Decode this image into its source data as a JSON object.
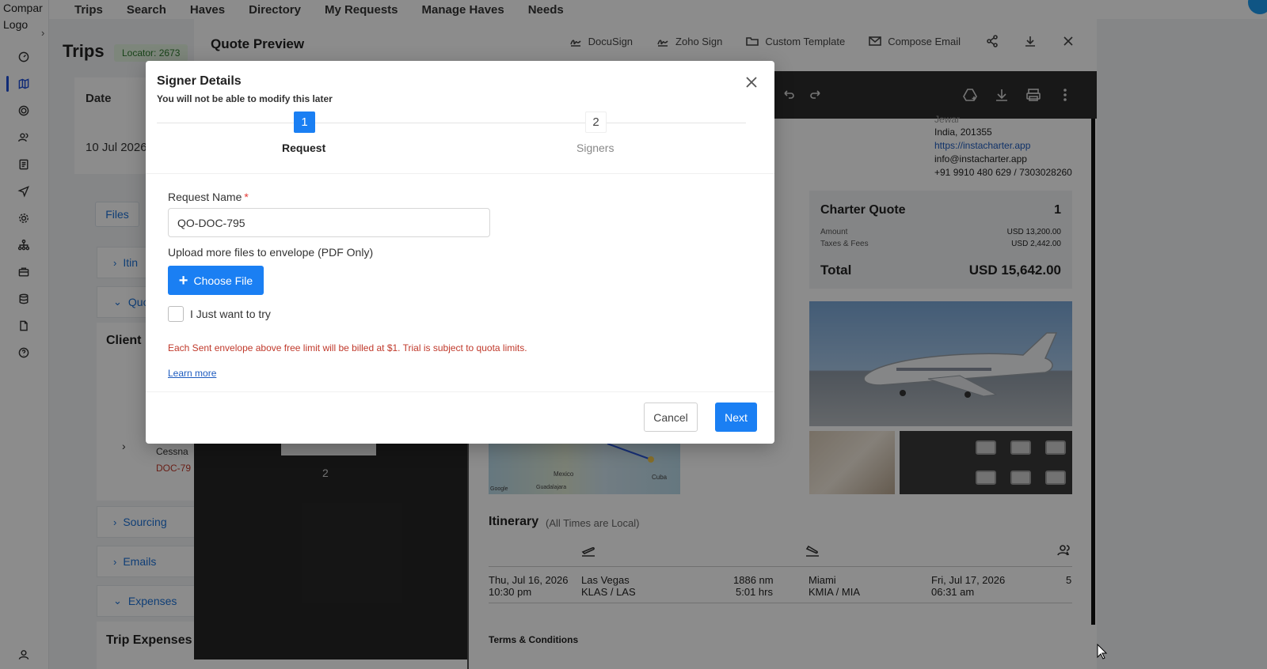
{
  "app": {
    "logo_text": "Compar\nLogo",
    "nav": [
      "Trips",
      "Search",
      "Haves",
      "Directory",
      "My Requests",
      "Manage Haves",
      "Needs"
    ]
  },
  "trips_page": {
    "title": "Trips",
    "locator": "Locator: 2673",
    "date_header": "Date",
    "date_value": "10 Jul 2026",
    "files_button": "Files",
    "accordion_partial_1": "Itin",
    "accordion_partial_2": "Quo",
    "client_title": "Client",
    "aircraft_partial": "Cessna",
    "doc_partial": "DOC-79",
    "sections": [
      "Sourcing",
      "Emails",
      "Expenses"
    ],
    "trip_expenses": "Trip Expenses"
  },
  "quote_preview": {
    "title": "Quote Preview",
    "actions": [
      "DocuSign",
      "Zoho Sign",
      "Custom Template",
      "Compose Email"
    ],
    "thumb_page_number": "2",
    "address_partial": "Jewar",
    "address_line": "India, 201355",
    "website": "https://instacharter.app",
    "email": "info@instacharter.app",
    "phones": "+91 9910 480 629 / 7303028260",
    "charter_quote": {
      "title": "Charter Quote",
      "number": "1",
      "amount_label": "Amount",
      "amount_value": "USD 13,200.00",
      "taxes_label": "Taxes & Fees",
      "taxes_value": "USD 2,442.00",
      "total_label": "Total",
      "total_value": "USD 15,642.00"
    },
    "map_labels": {
      "mexico": "Mexico",
      "cuba": "Cuba",
      "guadalajara": "Guadalajara",
      "google": "Google"
    },
    "itinerary": {
      "title": "Itinerary",
      "subtitle": "(All Times are Local)",
      "depart_date": "Thu, Jul 16, 2026",
      "depart_time": "10:30 pm",
      "origin_city": "Las Vegas",
      "origin_code": "KLAS / LAS",
      "distance": "1886 nm",
      "duration": "5:01 hrs",
      "dest_city": "Miami",
      "dest_code": "KMIA / MIA",
      "arrive_date": "Fri, Jul 17, 2026",
      "arrive_time": "06:31 am",
      "pax": "5"
    },
    "terms": "Terms & Conditions"
  },
  "modal": {
    "title": "Signer Details",
    "subtitle": "You will not be able to modify this later",
    "steps": [
      {
        "number": "1",
        "label": "Request"
      },
      {
        "number": "2",
        "label": "Signers"
      }
    ],
    "request_name_label": "Request Name",
    "request_name_required": "*",
    "request_name_value": "QO-DOC-795",
    "upload_label": "Upload more files to envelope (PDF Only)",
    "choose_file": "Choose File",
    "try_label": "I Just want to try",
    "warning": "Each Sent envelope above free limit will be billed at $1. Trial is subject to quota limits.",
    "learn_more": "Learn more",
    "cancel": "Cancel",
    "next": "Next"
  },
  "colors": {
    "primary": "#1a7ff3",
    "warning_text": "#c0392b",
    "link": "#1d5bbf",
    "viewer_dark": "#2d2d2d"
  }
}
